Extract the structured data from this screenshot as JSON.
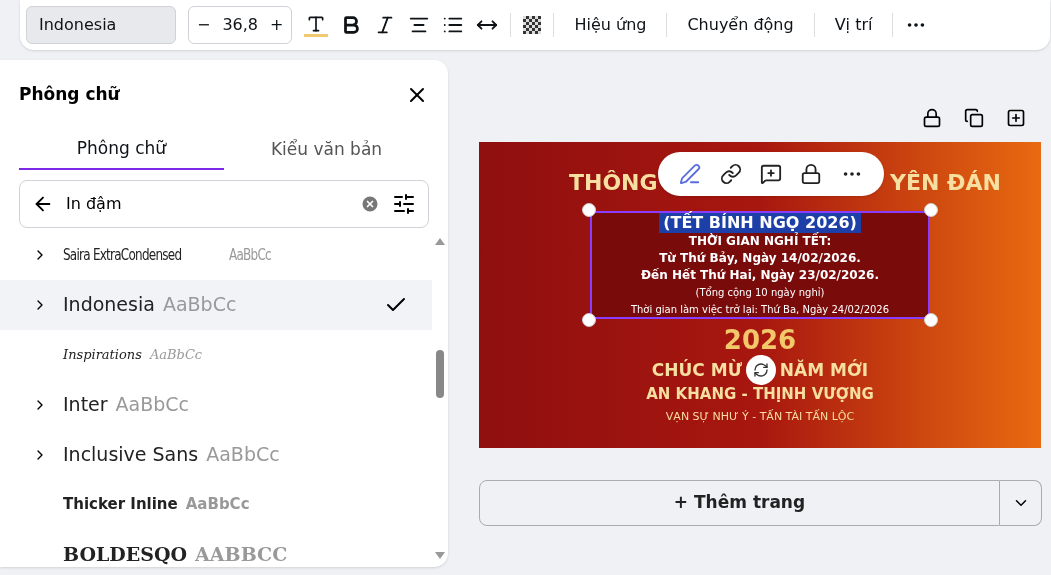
{
  "toolbar": {
    "font": "Indonesia",
    "size_minus": "−",
    "size": "36,8",
    "size_plus": "+",
    "effects": "Hiệu ứng",
    "animate": "Chuyển động",
    "position": "Vị trí"
  },
  "panel": {
    "title": "Phông chữ",
    "tabs": [
      {
        "label": "Phông chữ",
        "selected": true
      },
      {
        "label": "Kiểu văn bản",
        "selected": false
      }
    ],
    "search": {
      "value": "In đậm"
    },
    "fonts": [
      {
        "name": "Saira ExtraCondensed",
        "sample": "AaBbCc",
        "kind": "condensed",
        "expandable": true,
        "selected": false
      },
      {
        "name": "Indonesia",
        "sample": "AaBbCc",
        "kind": "sans",
        "expandable": true,
        "selected": true
      },
      {
        "name": "Inspirations",
        "sample": "AaBbCc",
        "kind": "script",
        "expandable": false,
        "selected": false
      },
      {
        "name": "Inter",
        "sample": "AaBbCc",
        "kind": "sans",
        "expandable": true,
        "selected": false
      },
      {
        "name": "Inclusive Sans",
        "sample": "AaBbCc",
        "kind": "sans",
        "expandable": true,
        "selected": false
      },
      {
        "name": "Thicker Inline",
        "sample": "AaBbCc",
        "kind": "heavy",
        "expandable": false,
        "selected": false
      },
      {
        "name": "BOLDESQO",
        "sample": "AABBCC",
        "kind": "slab",
        "expandable": false,
        "selected": false
      }
    ]
  },
  "design": {
    "title_left": "THÔNG",
    "title_right": "YÊN ĐÁN",
    "selected_lines": [
      "(TẾT BÍNH NGỌ 2026)",
      "THỜI GIAN NGHỈ TẾT:",
      "Từ Thứ Bảy, Ngày 14/02/2026.",
      "Đến Hết Thứ Hai, Ngày 23/02/2026.",
      "(Tổng cộng 10 ngày nghỉ)",
      "Thời gian làm việc trở lại: Thứ Ba, Ngày 24/02/2026"
    ],
    "year": "2026",
    "greeting_left": "CHÚC MỪ",
    "greeting_right": "NĂM MỚI",
    "wish": "AN KHANG - THỊNH VƯỢNG",
    "footer": "VẠN SỰ NHƯ Ý - TẤN TÀI TẤN LỘC"
  },
  "add_page": "+ Thêm trang"
}
